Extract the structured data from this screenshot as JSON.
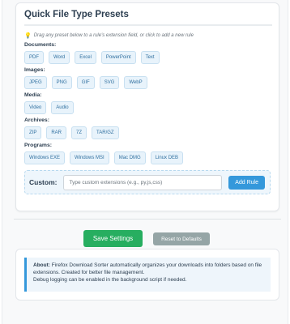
{
  "presets": {
    "title": "Quick File Type Presets",
    "hint_icon": "bulb-icon",
    "hint": "Drag any preset below to a rule's extension field, or click to add a new rule",
    "categories": [
      {
        "label": "Documents:",
        "items": [
          "PDF",
          "Word",
          "Excel",
          "PowerPoint",
          "Text"
        ]
      },
      {
        "label": "Images:",
        "items": [
          "JPEG",
          "PNG",
          "GIF",
          "SVG",
          "WebP"
        ]
      },
      {
        "label": "Media:",
        "items": [
          "Video",
          "Audio"
        ]
      },
      {
        "label": "Archives:",
        "items": [
          "ZIP",
          "RAR",
          "7Z",
          "TAR/GZ"
        ]
      },
      {
        "label": "Programs:",
        "items": [
          "Windows EXE",
          "Windows MSI",
          "Mac DMG",
          "Linux DEB"
        ]
      }
    ],
    "custom_label": "Custom:",
    "custom_placeholder": "Type custom extensions (e.g., py,js,css)",
    "add_rule_label": "Add Rule"
  },
  "actions": {
    "save_label": "Save Settings",
    "reset_label": "Reset to Defaults"
  },
  "about": {
    "title": "About:",
    "text": " Firefox Download Sorter automatically organizes your downloads into folders based on file extensions. Created for better file management.",
    "debug": "Debug logging can be enabled in the background script if needed."
  },
  "colors": {
    "save": "#27ae60",
    "reset": "#95a5a6",
    "accent": "#3498db"
  }
}
